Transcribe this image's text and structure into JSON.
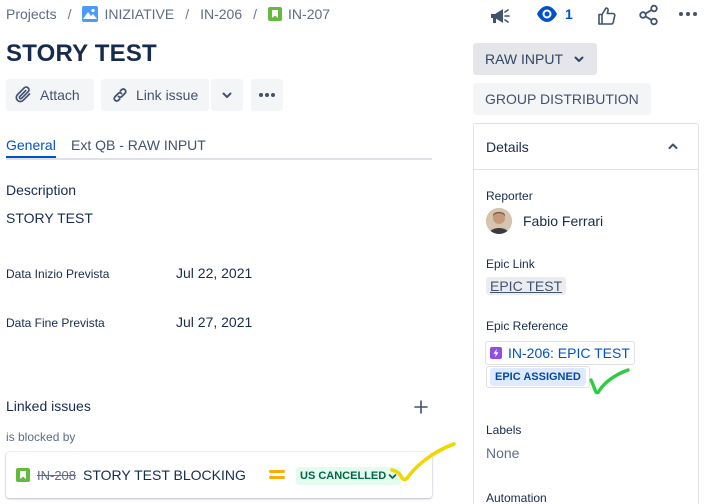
{
  "breadcrumbs": {
    "projects": "Projects",
    "separator": "/",
    "project": "INIZIATIVE",
    "epic": "IN-206",
    "issue": "IN-207"
  },
  "top_actions": {
    "announce_icon": "megaphone-icon",
    "watch_icon": "eye-icon",
    "watch_count": "1",
    "like_icon": "thumbs-up-icon",
    "share_icon": "share-icon",
    "more_icon": "more-horizontal-icon"
  },
  "issue": {
    "title": "STORY TEST"
  },
  "toolbar": {
    "attach_label": "Attach",
    "link_issue_label": "Link issue",
    "more_label": "•••"
  },
  "tabs": [
    {
      "label": "General",
      "active": true
    },
    {
      "label": "Ext QB - RAW INPUT",
      "active": false
    }
  ],
  "fields": {
    "description_label": "Description",
    "description_value": "STORY TEST",
    "start_date_label": "Data Inizio Prevista",
    "start_date_value": "Jul 22, 2021",
    "end_date_label": "Data Fine Prevista",
    "end_date_value": "Jul 27, 2021"
  },
  "linked": {
    "title": "Linked issues",
    "add_icon": "plus-icon",
    "relation": "is blocked by",
    "items": [
      {
        "key": "IN-208",
        "summary": "STORY TEST BLOCKING",
        "priority": "medium",
        "status": "US CANCELLED"
      }
    ]
  },
  "status": {
    "raw_input_label": "RAW INPUT",
    "group_distribution_label": "GROUP DISTRIBUTION"
  },
  "details": {
    "title": "Details",
    "reporter_label": "Reporter",
    "reporter_name": "Fabio Ferrari",
    "epic_link_label": "Epic Link",
    "epic_link_value": "EPIC TEST",
    "epic_reference_label": "Epic Reference",
    "epic_reference_value": "IN-206: EPIC TEST",
    "epic_status": "EPIC ASSIGNED",
    "labels_label": "Labels",
    "labels_value": "None",
    "automation_label": "Automation"
  },
  "colors": {
    "link_blue": "#0052cc",
    "story_green": "#63ba3c",
    "epic_purple": "#904ee2",
    "priority_orange": "#ffab00",
    "annotation_yellow": "#f2d600",
    "annotation_green": "#2ecc40"
  }
}
